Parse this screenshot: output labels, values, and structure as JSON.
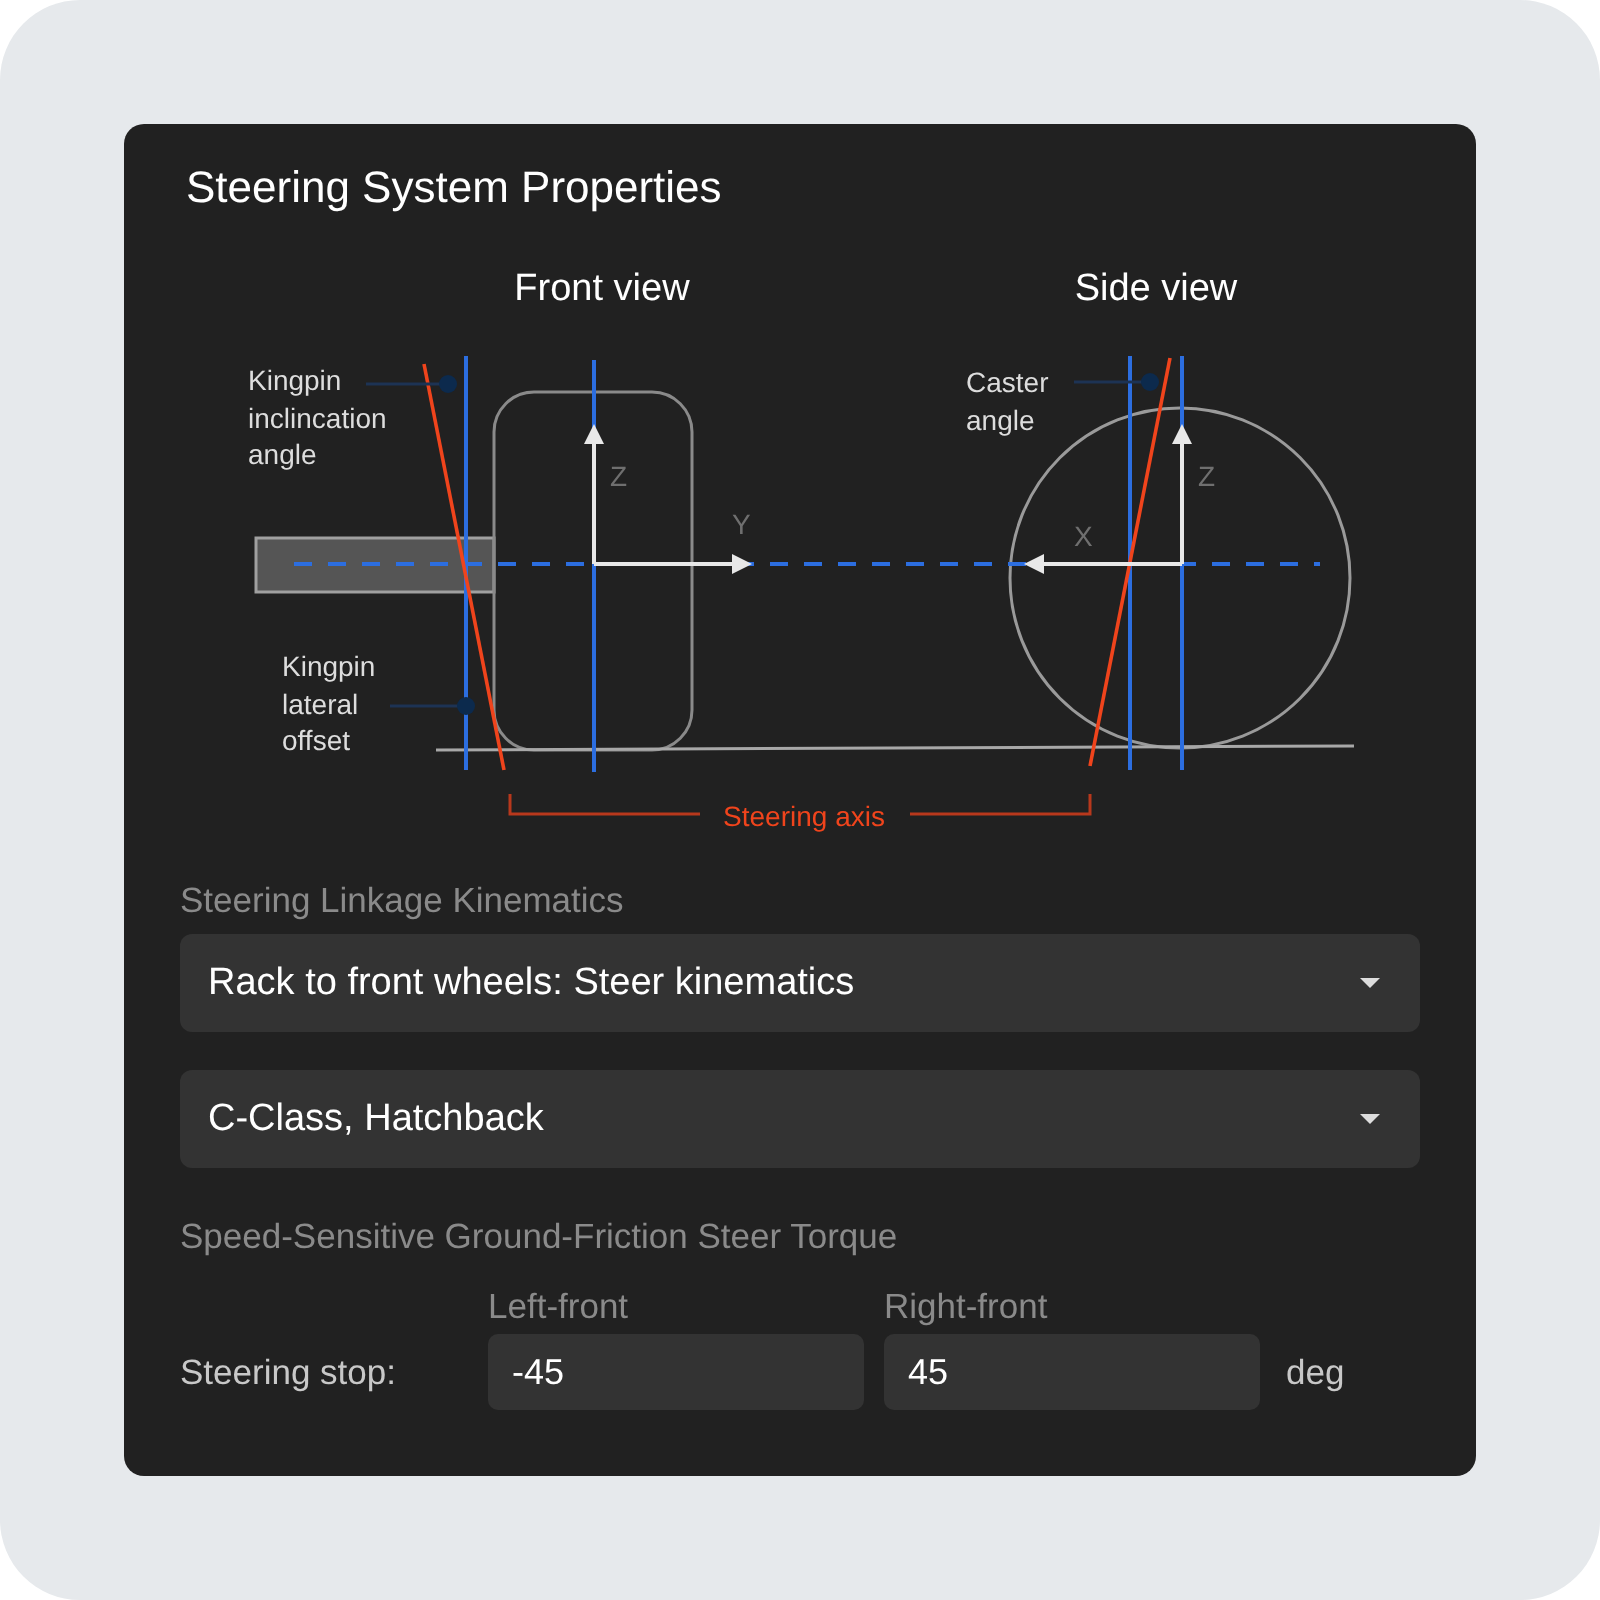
{
  "title": "Steering System Properties",
  "diagram": {
    "views": [
      {
        "title": "Front view"
      },
      {
        "title": "Side view"
      }
    ],
    "callouts": [
      {
        "text": "Kingpin inclincation angle"
      },
      {
        "text": "Kingpin lateral offset"
      },
      {
        "text": "Caster angle"
      }
    ],
    "axis_labels": [
      {
        "text": "Z"
      },
      {
        "text": "Y"
      },
      {
        "text": "Z"
      },
      {
        "text": "X"
      }
    ],
    "steering_axis_label": "Steering axis"
  },
  "linkage": {
    "label": "Steering Linkage Kinematics",
    "dropdowns": [
      {
        "value": "Rack to front wheels: Steer kinematics"
      },
      {
        "value": "C-Class, Hatchback"
      }
    ]
  },
  "steer_torque": {
    "heading": "Speed-Sensitive Ground-Friction Steer Torque",
    "row_label": "Steering stop:",
    "fields": [
      {
        "label": "Left-front",
        "value": "-45"
      },
      {
        "label": "Right-front",
        "value": "45"
      }
    ],
    "unit": "deg"
  }
}
